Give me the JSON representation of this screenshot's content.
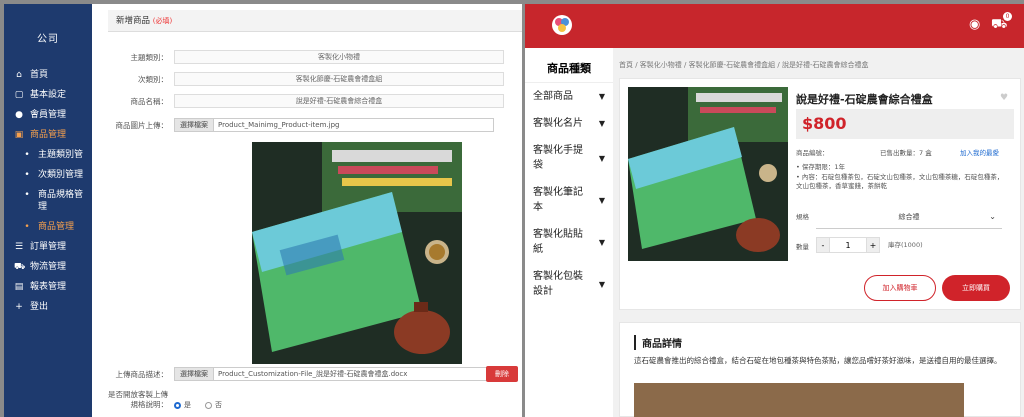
{
  "admin": {
    "sidebar": {
      "title": "公司",
      "items": [
        {
          "icon": "home-icon",
          "glyph": "⌂",
          "label": "首頁",
          "sub": false,
          "active": false
        },
        {
          "icon": "file-icon",
          "glyph": "▢",
          "label": "基本設定",
          "sub": false,
          "active": false
        },
        {
          "icon": "user-icon",
          "glyph": "●",
          "label": "會員管理",
          "sub": false,
          "active": false
        },
        {
          "icon": "product-icon",
          "glyph": "▣",
          "label": "商品管理",
          "sub": false,
          "active": true
        },
        {
          "icon": "tag-icon",
          "glyph": "•",
          "label": "主題類別管",
          "sub": true,
          "active": false
        },
        {
          "icon": "tag-icon",
          "glyph": "•",
          "label": "次類別管理",
          "sub": true,
          "active": false
        },
        {
          "icon": "tag-icon",
          "glyph": "•",
          "label": "商品規格管理",
          "sub": true,
          "active": false
        },
        {
          "icon": "tag-icon",
          "glyph": "•",
          "label": "商品管理",
          "sub": true,
          "active": true
        },
        {
          "icon": "order-icon",
          "glyph": "☰",
          "label": "訂單管理",
          "sub": false,
          "active": false
        },
        {
          "icon": "cart-icon",
          "glyph": "⛟",
          "label": "物流管理",
          "sub": false,
          "active": false
        },
        {
          "icon": "report-icon",
          "glyph": "▤",
          "label": "報表管理",
          "sub": false,
          "active": false
        },
        {
          "icon": "logout-icon",
          "glyph": "+",
          "label": "登出",
          "sub": false,
          "active": false
        }
      ]
    },
    "form": {
      "header": "新增商品",
      "header_req": "(必填)",
      "main_cat_label": "主題類別：",
      "main_cat_value": "客製化小物禮",
      "sub_cat_label": "次類別：",
      "sub_cat_value": "客製化節慶-石碇農會禮盒組",
      "name_label": "商品名稱：",
      "name_value": "說是好禮-石碇農會綜合禮盒",
      "image_label": "商品圖片上傳：",
      "upload_btn": "選擇檔案",
      "image_file": "Product_Mainimg_Product-item.jpg",
      "doc_label": "上傳商品描述：",
      "doc_btn": "選擇檔案",
      "doc_file": "Product_Customization-File_說是好禮-石碇農會禮盒.docx",
      "delete_btn": "刪除",
      "question_label": "是否開放客製上傳規格說明：",
      "radio_yes": "是",
      "radio_no": "否"
    }
  },
  "shop": {
    "categories_title": "商品種類",
    "categories": [
      "全部商品",
      "客製化名片",
      "客製化手提袋",
      "客製化筆記本",
      "客製化貼貼紙",
      "客製化包裝設計"
    ],
    "breadcrumb": "首頁 / 客製化小物禮 / 客製化節慶-石碇農會禮盒組 / 說是好禮-石碇農會綜合禮盒",
    "product": {
      "title": "說是好禮-石碇農會綜合禮盒",
      "price": "$800",
      "meta1": "商品編號：",
      "meta2": "已售出數量：7 盒",
      "meta3": "加入我的最愛",
      "detail1": "• 保存期限：1年",
      "detail2": "• 內容：石碇包種茶包，石碇文山包種茶，文山包種茶糖，石碇包種茶，文山包種茶，香草蜜餞，茶餅乾",
      "spec_label": "規格",
      "spec_value": "綜合禮",
      "qty_label": "數量",
      "qty_value": "1",
      "stock": "庫存(1000)",
      "add_cart": "加入購物車",
      "buy_now": "立即購買"
    },
    "detail": {
      "title": "商品詳情",
      "text": "這石碇農會推出的綜合禮盒，結合石碇在地包種茶與特色茶點，讓您品嚐好茶好滋味，是送禮自用的最佳選擇。"
    },
    "cart_badge": "0"
  },
  "colors": {
    "admin_sidebar": "#1e3a6e",
    "shop_topbar": "#c7262c",
    "accent_red": "#d0232a",
    "active_orange": "#f6a04d"
  }
}
